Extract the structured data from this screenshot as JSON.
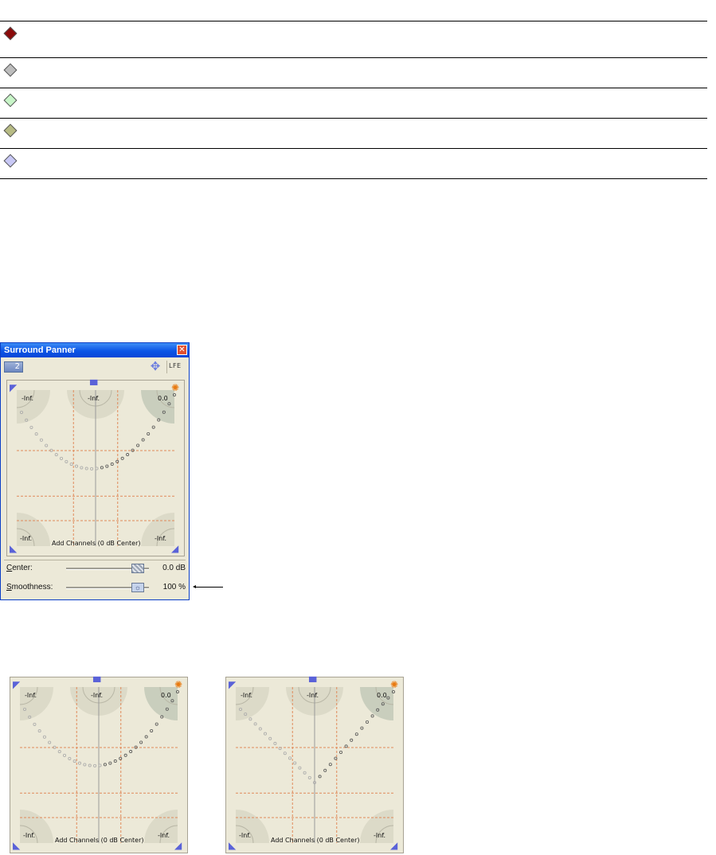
{
  "legend": {
    "rows": [
      {
        "icon": "keyframe-diamond-dark-red-icon",
        "color": "#8b0a0a"
      },
      {
        "icon": "keyframe-diamond-gray-icon",
        "color": "#bdbdbd"
      },
      {
        "icon": "keyframe-diamond-light-green-icon",
        "color": "#c8f5c8"
      },
      {
        "icon": "keyframe-diamond-olive-icon",
        "color": "#b7bb84"
      },
      {
        "icon": "keyframe-diamond-lavender-icon",
        "color": "#c8c8f5"
      }
    ]
  },
  "panner_window": {
    "title": "Surround Panner",
    "close_icon": "close-icon",
    "channel_value": "2",
    "move_icon": "move-icon",
    "lfe_label": "LFE",
    "panner": {
      "front_left_label": "-Inf.",
      "center_label": "-Inf.",
      "front_right_label": "0.0",
      "rear_left_label": "-Inf.",
      "rear_right_label": "-Inf.",
      "mode_label": "Add Channels (0 dB Center)"
    },
    "center_control": {
      "label_prefix": "C",
      "label_rest": "enter:",
      "value": "0.0 dB",
      "level": 0.93
    },
    "smoothness_control": {
      "label_prefix": "S",
      "label_rest": "moothness:",
      "value": "100 %",
      "level": 0.93
    }
  },
  "bottom_panners": [
    {
      "front_left_label": "-Inf.",
      "center_label": "-Inf.",
      "front_right_label": "0.0",
      "rear_left_label": "-Inf.",
      "rear_right_label": "-Inf.",
      "mode_label": "Add Channels (0 dB Center)"
    },
    {
      "front_left_label": "-Inf.",
      "center_label": "-Inf.",
      "front_right_label": "0.0",
      "rear_left_label": "-Inf.",
      "rear_right_label": "-Inf.",
      "mode_label": "Add Channels (0 dB Center)"
    }
  ]
}
